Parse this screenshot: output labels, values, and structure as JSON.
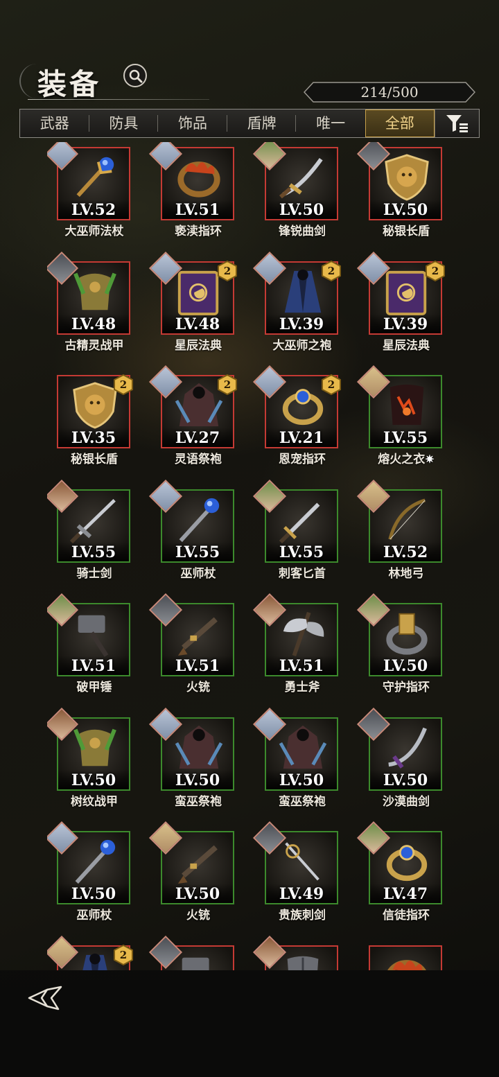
{
  "header": {
    "title": "装备",
    "count": "214/500"
  },
  "tabs": [
    {
      "label": "武器",
      "active": false
    },
    {
      "label": "防具",
      "active": false
    },
    {
      "label": "饰品",
      "active": false
    },
    {
      "label": "盾牌",
      "active": false
    },
    {
      "label": "唯一",
      "active": false
    },
    {
      "label": "全部",
      "active": true
    }
  ],
  "colors": {
    "accent_gold": "#c9a24b",
    "rarity_red": "#c53a34",
    "rarity_green": "#3c8a2c",
    "grade_badge": "#e8b94a"
  },
  "items": [
    {
      "name": "大巫师法杖",
      "level": "LV.52",
      "rarity": "red",
      "icon": "ornate-staff-icon",
      "hero": "silver-haired-hero",
      "grade": ""
    },
    {
      "name": "亵渎指环",
      "level": "LV.51",
      "rarity": "red",
      "icon": "flame-ring-icon",
      "hero": "silver-haired-hero",
      "grade": ""
    },
    {
      "name": "锋锐曲剑",
      "level": "LV.50",
      "rarity": "red",
      "icon": "curved-sword-icon",
      "hero": "green-hooded-hero",
      "grade": ""
    },
    {
      "name": "秘银长盾",
      "level": "LV.50",
      "rarity": "red",
      "icon": "lion-shield-icon",
      "hero": "dark-armored-hero",
      "grade": ""
    },
    {
      "name": "古精灵战甲",
      "level": "LV.48",
      "rarity": "red",
      "icon": "leaf-armor-icon",
      "hero": "dark-armored-hero",
      "grade": ""
    },
    {
      "name": "星辰法典",
      "level": "LV.48",
      "rarity": "red",
      "icon": "spellbook-icon",
      "hero": "silver-haired-hero",
      "grade": "2"
    },
    {
      "name": "大巫师之袍",
      "level": "LV.39",
      "rarity": "red",
      "icon": "blue-robe-icon",
      "hero": "silver-haired-hero",
      "grade": "2"
    },
    {
      "name": "星辰法典",
      "level": "LV.39",
      "rarity": "red",
      "icon": "spellbook-icon",
      "hero": "silver-haired-hero",
      "grade": "2"
    },
    {
      "name": "秘银长盾",
      "level": "LV.35",
      "rarity": "red",
      "icon": "lion-shield-icon",
      "hero": "",
      "grade": "2"
    },
    {
      "name": "灵语祭袍",
      "level": "LV.27",
      "rarity": "red",
      "icon": "feather-robe-icon",
      "hero": "silver-haired-hero",
      "grade": "2"
    },
    {
      "name": "恩宠指环",
      "level": "LV.21",
      "rarity": "red",
      "icon": "sapphire-ring-icon",
      "hero": "silver-haired-hero",
      "grade": "2"
    },
    {
      "name": "熔火之衣",
      "level": "LV.55",
      "rarity": "green",
      "icon": "lava-armor-icon",
      "hero": "blonde-hero",
      "grade": "",
      "mark": "✷"
    },
    {
      "name": "骑士剑",
      "level": "LV.55",
      "rarity": "green",
      "icon": "longsword-icon",
      "hero": "brown-haired-hero",
      "grade": ""
    },
    {
      "name": "巫师杖",
      "level": "LV.55",
      "rarity": "green",
      "icon": "orb-staff-icon",
      "hero": "silver-haired-hero",
      "grade": ""
    },
    {
      "name": "刺客匕首",
      "level": "LV.55",
      "rarity": "green",
      "icon": "dagger-icon",
      "hero": "green-hooded-hero",
      "grade": ""
    },
    {
      "name": "林地弓",
      "level": "LV.52",
      "rarity": "green",
      "icon": "bow-icon",
      "hero": "blonde-hero",
      "grade": ""
    },
    {
      "name": "破甲锤",
      "level": "LV.51",
      "rarity": "green",
      "icon": "warhammer-icon",
      "hero": "green-hooded-hero",
      "grade": ""
    },
    {
      "name": "火铳",
      "level": "LV.51",
      "rarity": "green",
      "icon": "pistol-icon",
      "hero": "dark-armored-hero",
      "grade": ""
    },
    {
      "name": "勇士斧",
      "level": "LV.51",
      "rarity": "green",
      "icon": "battle-axe-icon",
      "hero": "brown-haired-hero",
      "grade": ""
    },
    {
      "name": "守护指环",
      "level": "LV.50",
      "rarity": "green",
      "icon": "gold-band-ring-icon",
      "hero": "green-hooded-hero",
      "grade": ""
    },
    {
      "name": "树纹战甲",
      "level": "LV.50",
      "rarity": "green",
      "icon": "leaf-armor-icon",
      "hero": "brown-haired-hero",
      "grade": ""
    },
    {
      "name": "蛮巫祭袍",
      "level": "LV.50",
      "rarity": "green",
      "icon": "feather-robe-icon",
      "hero": "silver-haired-hero",
      "grade": ""
    },
    {
      "name": "蛮巫祭袍",
      "level": "LV.50",
      "rarity": "green",
      "icon": "feather-robe-icon",
      "hero": "silver-haired-hero",
      "grade": ""
    },
    {
      "name": "沙漠曲剑",
      "level": "LV.50",
      "rarity": "green",
      "icon": "scimitar-icon",
      "hero": "dark-armored-hero",
      "grade": ""
    },
    {
      "name": "巫师杖",
      "level": "LV.50",
      "rarity": "green",
      "icon": "orb-staff-icon",
      "hero": "silver-haired-hero",
      "grade": ""
    },
    {
      "name": "火铳",
      "level": "LV.50",
      "rarity": "green",
      "icon": "pistol-icon",
      "hero": "blonde-hero",
      "grade": ""
    },
    {
      "name": "贵族刺剑",
      "level": "LV.49",
      "rarity": "green",
      "icon": "rapier-icon",
      "hero": "dark-armored-hero",
      "grade": ""
    },
    {
      "name": "信徒指环",
      "level": "LV.47",
      "rarity": "green",
      "icon": "sapphire-ring-icon",
      "hero": "green-hooded-hero",
      "grade": ""
    },
    {
      "name": "",
      "level": "",
      "rarity": "red",
      "icon": "blue-robe-icon",
      "hero": "blonde-hero",
      "grade": "2"
    },
    {
      "name": "",
      "level": "",
      "rarity": "red",
      "icon": "warhammer-icon",
      "hero": "dark-armored-hero",
      "grade": ""
    },
    {
      "name": "",
      "level": "",
      "rarity": "red",
      "icon": "plate-armor-icon",
      "hero": "brown-haired-hero",
      "grade": ""
    },
    {
      "name": "",
      "level": "",
      "rarity": "red",
      "icon": "flame-ring-icon",
      "hero": "",
      "grade": ""
    }
  ],
  "footer": {
    "back_icon": "back-arrow-icon"
  }
}
